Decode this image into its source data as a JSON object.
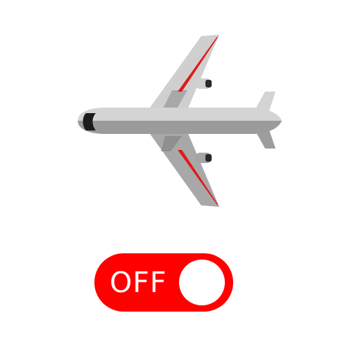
{
  "airplane_icon": {
    "icon": "airplane-icon",
    "colors": {
      "fuselage": "#d4d4d4",
      "shadow": "#9b9b9b",
      "wing_light": "#cfcfcf",
      "wing_dark": "#a0a0a0",
      "stripe": "#e01919",
      "cockpit": "#1c1c1c"
    }
  },
  "airplane_mode_toggle": {
    "label": "OFF",
    "state": "off",
    "track_color": "#ff0000",
    "knob_color": "#ffffff",
    "text_color": "#ffffff"
  }
}
